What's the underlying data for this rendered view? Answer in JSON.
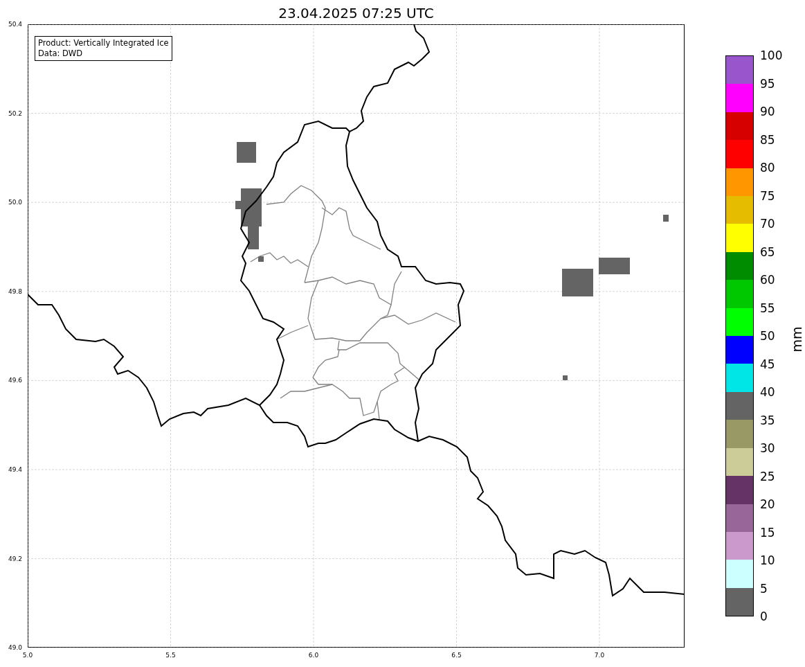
{
  "title": "23.04.2025 07:25 UTC",
  "info_box": {
    "lines": [
      "Product: Vertically Integrated Ice",
      "Data: DWD"
    ]
  },
  "map": {
    "xticks": [
      "5.0",
      "5.5",
      "6.0",
      "6.5",
      "7.0"
    ],
    "yticks": [
      "50.4",
      "50.2",
      "50.0",
      "49.8",
      "49.6",
      "49.4",
      "49.2",
      "49.0"
    ]
  },
  "colorbar": {
    "label": "mm",
    "segments": [
      {
        "color": "#9955cc"
      },
      {
        "color": "#ff00ff"
      },
      {
        "color": "#d60000"
      },
      {
        "color": "#ff0000"
      },
      {
        "color": "#ff9600"
      },
      {
        "color": "#e5bc00"
      },
      {
        "color": "#ffff00"
      },
      {
        "color": "#008c00"
      },
      {
        "color": "#00c800"
      },
      {
        "color": "#00ff00"
      },
      {
        "color": "#0000ff"
      },
      {
        "color": "#00e5e5"
      },
      {
        "color": "#646464"
      },
      {
        "color": "#999966"
      },
      {
        "color": "#cccc99"
      },
      {
        "color": "#663366"
      },
      {
        "color": "#996699"
      },
      {
        "color": "#cc99cc"
      },
      {
        "color": "#ccffff"
      },
      {
        "color": "#646464"
      }
    ],
    "ticks": [
      "100",
      "95",
      "90",
      "85",
      "80",
      "75",
      "70",
      "65",
      "60",
      "55",
      "50",
      "45",
      "40",
      "35",
      "30",
      "25",
      "20",
      "15",
      "10",
      "5",
      "0"
    ]
  }
}
